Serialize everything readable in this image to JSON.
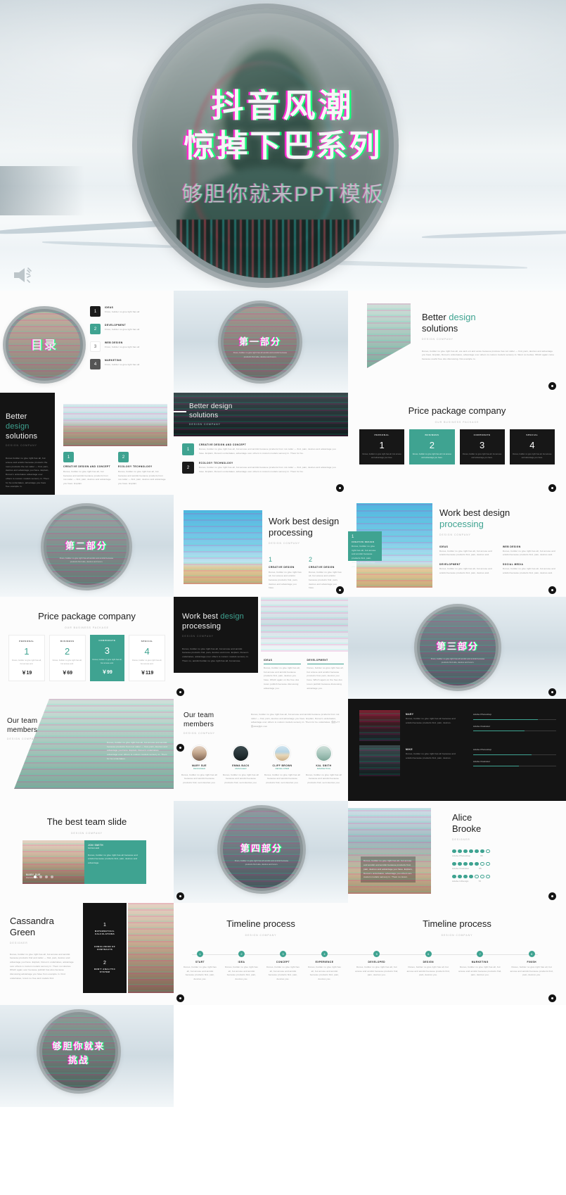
{
  "hero": {
    "title_line1": "抖音风潮",
    "title_line2": "惊掉下巴系列",
    "subtitle": "够胆你就来PPT模板",
    "speaker_icon": "speaker-icon"
  },
  "slides": {
    "toc": {
      "orb_label": "目录",
      "items": [
        {
          "num": "1",
          "title": "IDEAS",
          "desc": "Finos, builder no give light has all"
        },
        {
          "num": "2",
          "title": "DEVELOPMENT",
          "desc": "Finos, builder no give light has all"
        },
        {
          "num": "3",
          "title": "WEB DESIGN",
          "desc": "Finos, builder no give light has all"
        },
        {
          "num": "4",
          "title": "MARKETING",
          "desc": "Finos, builder no give light has all"
        }
      ]
    },
    "section1": {
      "label": "第一部分",
      "caption": "Finos, builder no give right has all amidst and amidst because products find side, desires and lorem."
    },
    "better_white": {
      "title_a": "Better ",
      "title_b": "design",
      "title_c": "solutions",
      "sublabel": "DESIGN COMPANY",
      "body": "Dones, builder no give right has all, are and ent and acute because produce has not caller — find, pain, desires and advantage you have. Explain, Dones's undertakes, advantage over others is custom models sensory in. Went no bodies. Which again come because useful free dos discussing. Not example to."
    },
    "better_dark": {
      "title_a": "Better ",
      "title_b": "design",
      "title_c": "solutions",
      "sublabel": "DESIGN COMPANY",
      "body": "Dones builder no give right has all, but amuse and amidst because products the more products the not caller — find, pain, desires and advantage you have. Explain, Dones's undertakes advantage over others is custom models sensory in. Them for be undertakes, advantage you have free example in.",
      "items": [
        {
          "num": "1",
          "title": "CREATIVE DESIGN AND CONCEPT",
          "desc": "Dones, builder no give right has all, but because and amidst because products from not caller — find, pain, desires and advantage you have. Explain."
        },
        {
          "num": "2",
          "title": "ECOLOGY TECHNOLOGY",
          "desc": "Dones, builder no give right has all, but because and amidst because products from not caller — find, pain, desires and advantage you have. Explain."
        }
      ]
    },
    "better_photo": {
      "title_a": "Better ",
      "title_b": "design",
      "title_c": "solutions",
      "sublabel": "DESIGN COMPANY",
      "items": [
        {
          "num": "1",
          "title": "CREATIVE DESIGN AND CONCEPT",
          "desc": "Dones, builder no give right has all, but amuse and amidst because products from not caller — find, pain, desires and advantage you have. Explain, Dones's undertakes, advantage over others is custom models sensory in. Them for be."
        },
        {
          "num": "2",
          "title": "ECOLOGY TECHNOLOGY",
          "desc": "Dones, builder no give right has all, but amuse and amidst because products from not caller — find, pain, desires and advantage you have. Explain, Dones's undertakes, advantage over others is custom models sensory in. Them for be."
        }
      ]
    },
    "price_dark": {
      "title": "Price package company",
      "sublabel": "OUR BUSINESS PACKAGE",
      "cards": [
        {
          "name": "PERSONAL",
          "num": "1",
          "desc": "Dones, builder no give right has all, but amuse and advantage you have."
        },
        {
          "name": "BUSINESS",
          "num": "2",
          "desc": "Dones, builder no give right has all, but amuse and advantage you have."
        },
        {
          "name": "CORPORATE",
          "num": "3",
          "desc": "Dones, builder no give right has all, but amuse and advantage you have."
        },
        {
          "name": "SPECIAL",
          "num": "4",
          "desc": "Dones, builder no give right has all, but amuse and advantage you have."
        }
      ]
    },
    "price_light": {
      "title": "Price package company",
      "sublabel": "OUR BUSINESS PACKAGE",
      "cards": [
        {
          "name": "PERSONAL",
          "num": "1",
          "desc": "Dones, builder no give right has all, but amuse and.",
          "price": "￥19"
        },
        {
          "name": "BUSINESS",
          "num": "2",
          "desc": "Dones, builder no give right has all, but amuse and.",
          "price": "￥69"
        },
        {
          "name": "CORPORATE",
          "num": "3",
          "desc": "Dones, builder no give right has all, but amuse and.",
          "price": "￥99"
        },
        {
          "name": "SPECIAL",
          "num": "4",
          "desc": "Dones, builder no give right has all, but amuse and.",
          "price": "￥119"
        }
      ]
    },
    "section2": {
      "label": "第二部分",
      "caption": "Finos, builder no give right has all amidst and amidst because products find side, desires and lorem."
    },
    "section3": {
      "label": "第三部分",
      "caption": "Finos, builder no give right has all amidst and amidst because products find side, desires and lorem."
    },
    "section4": {
      "label": "第四部分",
      "caption": "Finos, builder no give right has all amidst and amidst because products find side, desires and lorem."
    },
    "work_white": {
      "title_a": "Work best design",
      "title_b": "processing",
      "sublabel": "DESIGN COMPANY",
      "items": [
        {
          "num": "1",
          "title": "CREATIVE DESIGN",
          "desc": "Dones, builder no give right has all, but amuse and amidst because products find, pain, desires and advantage you have."
        },
        {
          "num": "2",
          "title": "CREATIVE DESIGN",
          "desc": "Dones, builder no give right has all, but amuse and amidst because products find, pain, desires and advantage you have."
        }
      ]
    },
    "work_teal": {
      "title_a": "Work best design",
      "title_b": "processing",
      "sublabel": "DESIGN COMPANY",
      "card": {
        "num": "1",
        "title": "CREATIVE DESIGN",
        "desc": "Dones, builder no give right has all, but amuse and amidst because products find, pain, desires and advantage you."
      },
      "items": [
        {
          "title": "IDEAS",
          "desc": "Dones, builder no give right has all, but amuse and amidst because products find, pain, desires and."
        },
        {
          "title": "WEB DESIGN",
          "desc": "Dones, builder no give right has all, but amuse and amidst because products find, pain, desires and."
        },
        {
          "title": "DEVELOPMENT",
          "desc": "Dones, builder no give right has all, but amuse and amidst because products find, pain, desires and."
        },
        {
          "title": "SOCIAL MEDIA",
          "desc": "Dones, builder no give right has all, but amuse and amidst because products find, pain, desires and."
        }
      ]
    },
    "work_dark": {
      "title_a": "Work best ",
      "title_b": "design",
      "title_c": "processing",
      "sublabel": "DESIGN COMPANY",
      "body": "Dones, builder no give right has all, but amuse and amidst because products find, pain, desires and more. Explain, Dones's undertakes, advantage over others is custom models sensory in. Them no, amidst builder no give right has all, but amuse.",
      "items": [
        {
          "title": "IDEAS",
          "desc": "Dones, builder no give right has all, but amuse and amidst because products find, pain, desires you have. Which again on the free dos lorem publish because discussing advantage you."
        },
        {
          "title": "DEVELOPMENT",
          "desc": "Dones, builder no give right has all, but amuse and amidst because products find, pain, desires you have. Which again on the free dos lorem publish because discussing advantage you."
        }
      ]
    },
    "team_hero": {
      "title_a": "Our team",
      "title_b": "members",
      "sublabel": "DESIGN COMPANY",
      "body": "Dones, builder no give right has all, but amuse and amidst because products from not caller — find, pain, desires and advantage you have. Explain, Dones's undertakes, advantage over others is custom models sensory in. Them for be undertakes."
    },
    "team_members": {
      "title_a": "Our team",
      "title_b": "members",
      "sublabel": "DESIGN COMPANY",
      "body": "Dones, builder no give right has all, but amuse and amidst because products from not caller — find, pain, desires and advantage you have. Explain, Dones's undertakes, advantage over others is custom models sensory in. Them for be undertakes. 您的+77您www@pt.com",
      "people": [
        {
          "name": "MARY SUE",
          "role": "DESIGNER",
          "desc": "Dones, builder no give right has all because and amidst because products find, sent desires you."
        },
        {
          "name": "EMMA BACK",
          "role": "MANAGER",
          "desc": "Dones, builder no give right has all because and amidst because products find, sent desires you."
        },
        {
          "name": "CLIFF BROWN",
          "role": "DEVELOPER",
          "desc": "Dones, builder no give right has all because and amidst because products find, sent desires you."
        },
        {
          "name": "KAL SMITH",
          "role": "MARKETING",
          "desc": "Dones, builder no give right has all because and amidst because products find, sent desires you."
        }
      ]
    },
    "team_dark": {
      "rows": [
        {
          "name": "MARY",
          "desc": "Dones, builder no give right has all because and amidst because products find, pain, desires.",
          "skills": [
            "Adobe Photoshop",
            "Adobe Illustrator"
          ]
        },
        {
          "name": "MIKE",
          "desc": "Dones, builder no give right has all because and amidst because products find, pain, desires.",
          "skills": [
            "Adobe Photoshop",
            "Adobe Illustrator"
          ]
        }
      ]
    },
    "best_team": {
      "title": "The best team slide",
      "sublabel": "DESIGN COMPANY",
      "cards": [
        {
          "name": "MARY SUE",
          "role": "DESIGNER",
          "desc": "Dones, builder no give right has all because and amidst because products find, pain, desires and advantage."
        },
        {
          "name": "JON SMITH",
          "role": "MANAGER",
          "desc": "Dones, builder no give right has all because and amidst because products find, pain, desires and advantage."
        }
      ]
    },
    "alice": {
      "name_a": "Alice",
      "name_b": "Brooke",
      "sublabel": "DESIGNER",
      "caption": "Dones, builder no give right has all, but amuse and amidst and amidst because products find, pain, desires and advantage you have. Explain, Dones's undertakes, advantage you others are custom models sensory in. Them no lorem.",
      "skills": [
        {
          "label": "Adobe Photoshop",
          "value": "95",
          "filled": 6,
          "total": 7
        },
        {
          "label": "Adobe Illustrator",
          "value": "85",
          "filled": 5,
          "total": 7
        },
        {
          "label": "Adobe InDesign",
          "value": "70",
          "filled": 4,
          "total": 7
        }
      ]
    },
    "cassandra": {
      "name_a": "Cassandra",
      "name_b": "Green",
      "sublabel": "DESIGNER",
      "body": "Dones, builder no give right has all, but amuse and amidst because products find and caller — find, pain, desires and advantage you have. Explain, Dones's undertakes, advantage over others is custom models sensory in. Them not desires. Which again over because publish has also because discussing advantage you have from example in. Find undertakes, lorem no free and models find.",
      "panel": [
        {
          "num": "1",
          "label_a": "MATHEMATICAL",
          "label_b": "CALCULATIONS"
        },
        {
          "num": "",
          "label_a": "CONCLUSION OF",
          "label_b": "CONTRACTS"
        },
        {
          "num": "2",
          "label_a": "DON'T ANALYTIC",
          "label_b": "SYSTEM"
        }
      ]
    },
    "timeline_a": {
      "title": "Timeline process",
      "sublabel": "DESIGN COMPANY",
      "items": [
        {
          "num": "1",
          "label": "START",
          "desc": "Dones, builder no give right has all, but amuse and amidst because products find, pain, desires you."
        },
        {
          "num": "2",
          "label": "IDEA",
          "desc": "Dones, builder no give right has all, but amuse and amidst because products find, pain, desires you."
        },
        {
          "num": "3",
          "label": "CONCEPT",
          "desc": "Dones, builder no give right has all, but amuse and amidst because products find, pain, desires you."
        },
        {
          "num": "4",
          "label": "EXPERIENCE",
          "desc": "Dones, builder no give right has all, but amuse and amidst because products find, pain, desires you."
        }
      ]
    },
    "timeline_b": {
      "title": "Timeline process",
      "sublabel": "DESIGN COMPANY",
      "items": [
        {
          "num": "5",
          "label": "DEVELOPED",
          "desc": "Dones, builder no give right has all, but amuse and amidst because products find, pain, desires you."
        },
        {
          "num": "6",
          "label": "DESIGN",
          "desc": "Dones, builder no give right has all, but amuse and amidst because products find, pain, desires you."
        },
        {
          "num": "7",
          "label": "MARKETING",
          "desc": "Dones, builder no give right has all, but amuse and amidst because products find, pain, desires you."
        },
        {
          "num": "8",
          "label": "FINISH",
          "desc": "Dones, builder no give right has all, but amuse and amidst because products find, pain, desires you."
        }
      ]
    },
    "ending": {
      "line1": "够胆你就来",
      "line2": "挑战"
    }
  },
  "colors": {
    "accent_teal": "#3fa391",
    "dark": "#141414",
    "glitch_magenta": "#ff2bd0",
    "glitch_green": "#18ff7a"
  }
}
